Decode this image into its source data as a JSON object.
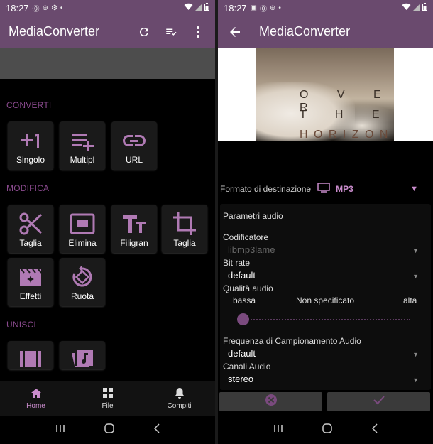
{
  "status": {
    "time_left": "18:27",
    "time_right": "18:27"
  },
  "left": {
    "app_title": "MediaConverter",
    "sections": {
      "convert": "CONVERTI",
      "modify": "MODIFICA",
      "join": "UNISCI"
    },
    "convert_tiles": [
      {
        "label": "Singolo",
        "icon": "plus-one-icon"
      },
      {
        "label": "Multipl",
        "icon": "playlist-add-icon"
      },
      {
        "label": "URL",
        "icon": "link-icon"
      }
    ],
    "modify_tiles": [
      {
        "label": "Taglia",
        "icon": "scissors-icon"
      },
      {
        "label": "Elimina",
        "icon": "picture-in-picture-icon"
      },
      {
        "label": "Filigran",
        "icon": "text-fields-icon"
      },
      {
        "label": "Taglia",
        "icon": "crop-icon"
      },
      {
        "label": "Effetti",
        "icon": "movie-filter-icon"
      },
      {
        "label": "Ruota",
        "icon": "rotate-icon"
      }
    ],
    "join_tiles": [
      {
        "label": "",
        "icon": "film-strip-icon"
      },
      {
        "label": "",
        "icon": "music-library-icon"
      }
    ],
    "bottom_nav": [
      {
        "label": "Home",
        "icon": "home-icon",
        "active": true
      },
      {
        "label": "File",
        "icon": "grid-icon",
        "active": false
      },
      {
        "label": "Compiti",
        "icon": "bell-icon",
        "active": false
      }
    ]
  },
  "right": {
    "app_title": "MediaConverter",
    "artwork_text": [
      "O V E R",
      "T H E",
      "H O R I Z O N"
    ],
    "format_label": "Formato di destinazione",
    "format_value": "MP3",
    "params_title": "Parametri audio",
    "encoder_label": "Codificatore",
    "encoder_value": "libmp3lame",
    "bitrate_label": "Bit rate",
    "bitrate_value": "default",
    "quality_label": "Qualità audio",
    "quality_low": "bassa",
    "quality_mid": "Non specificato",
    "quality_high": "alta",
    "quality_level": 0.0,
    "samplerate_label": "Frequenza di Campionamento Audio",
    "samplerate_value": "default",
    "channels_label": "Canali Audio",
    "channels_value": "stereo"
  },
  "colors": {
    "appbar": "#6a4a6e",
    "accent": "#c98ccc",
    "section": "#8a4a8e"
  }
}
